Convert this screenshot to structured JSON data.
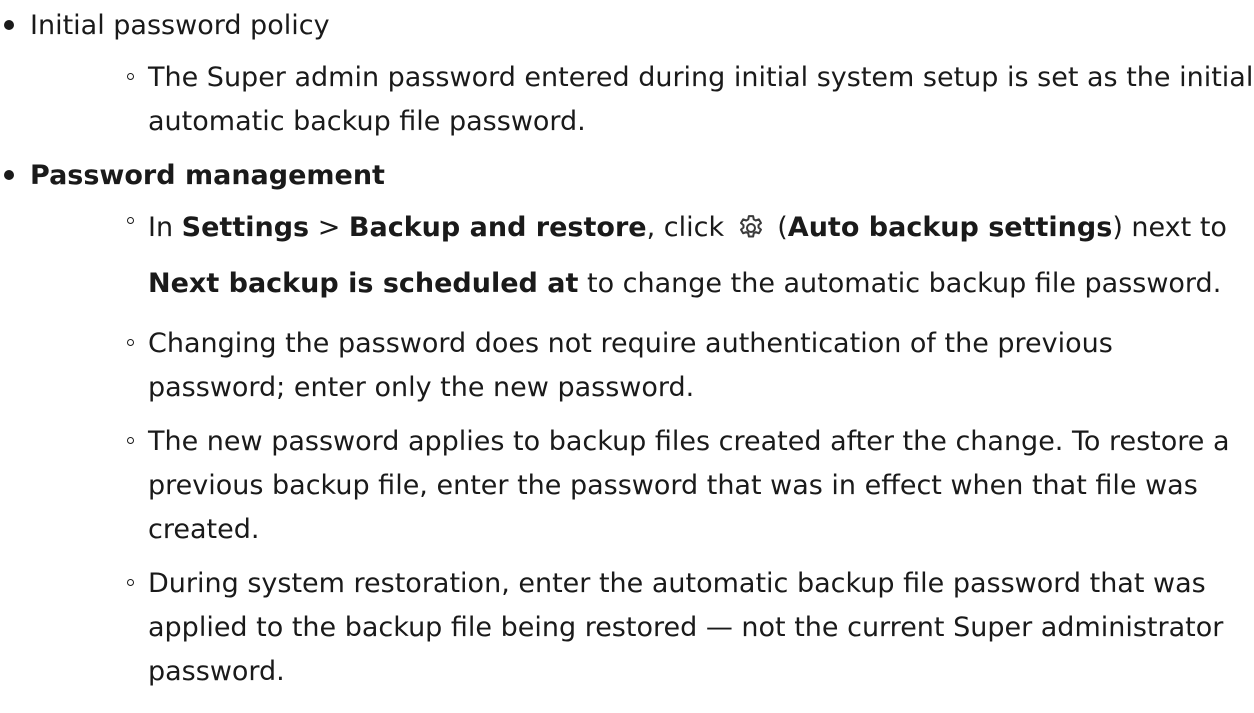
{
  "sections": [
    {
      "heading": "Initial password policy",
      "items": [
        "The Super admin password entered during initial system setup is set as the initial automatic backup file password."
      ]
    },
    {
      "heading": "Password management",
      "items": [
        {
          "in": "In ",
          "settings": "Settings",
          "sep": " > ",
          "backup_restore": "Backup and restore",
          "click": ", click ",
          "paren_open": " (",
          "auto_backup_settings": "Auto backup settings",
          "paren_close_next_to": ") next to ",
          "next_backup": "Next backup is scheduled at",
          "tail": " to change the automatic backup file password."
        },
        "Changing the password does not require authentication of the previous password; enter only the new password.",
        "The new password applies to backup files created after the change. To restore a previous backup file, enter the password that was in effect when that file was created.",
        "During system restoration, enter the automatic backup file password that was applied to the backup file being restored — not the current Super administrator password."
      ]
    }
  ],
  "icons": {
    "gear": "gear-icon"
  }
}
